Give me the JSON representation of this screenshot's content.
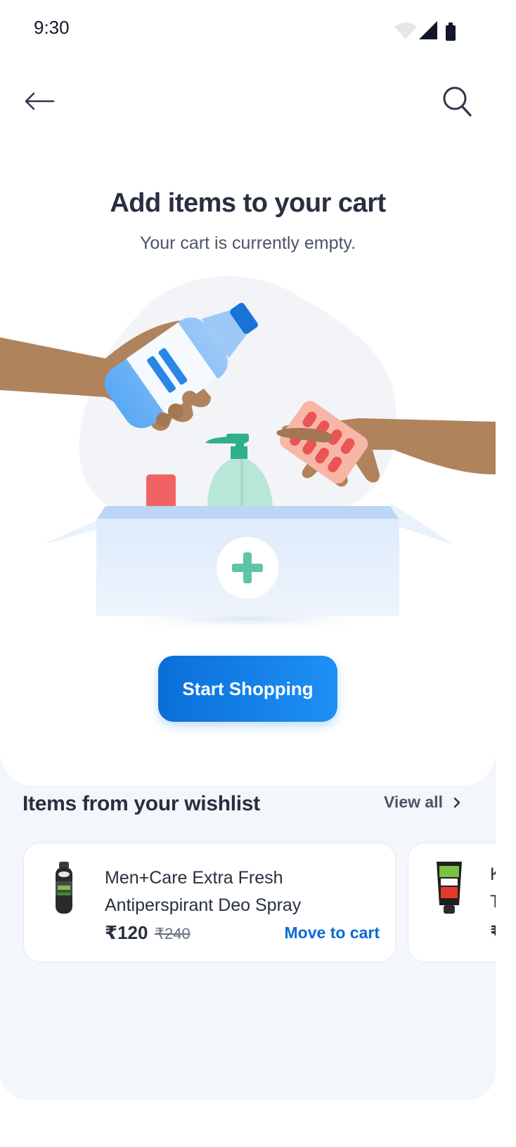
{
  "status_bar": {
    "time": "9:30"
  },
  "header": {
    "back_icon": "arrow-left-icon",
    "search_icon": "search-icon"
  },
  "empty_state": {
    "title": "Add items to your cart",
    "subtitle": "Your cart is currently empty.",
    "cta_label": "Start Shopping",
    "illustration": "hands-adding-medicines-to-box"
  },
  "wishlist": {
    "title": "Items from your wishlist",
    "view_all_label": "View all",
    "items": [
      {
        "name_line1": "Men+Care Extra Fresh",
        "name_line2": "Antiperspirant Deo Spray",
        "price": "₹120",
        "mrp": "₹240",
        "action_label": "Move to cart"
      },
      {
        "name_line1": "K",
        "name_line2": "T",
        "price": "₹"
      }
    ]
  },
  "colors": {
    "primary": "#0b6bd3",
    "text_dark": "#27303f",
    "section_bg": "#f3f6fa"
  }
}
